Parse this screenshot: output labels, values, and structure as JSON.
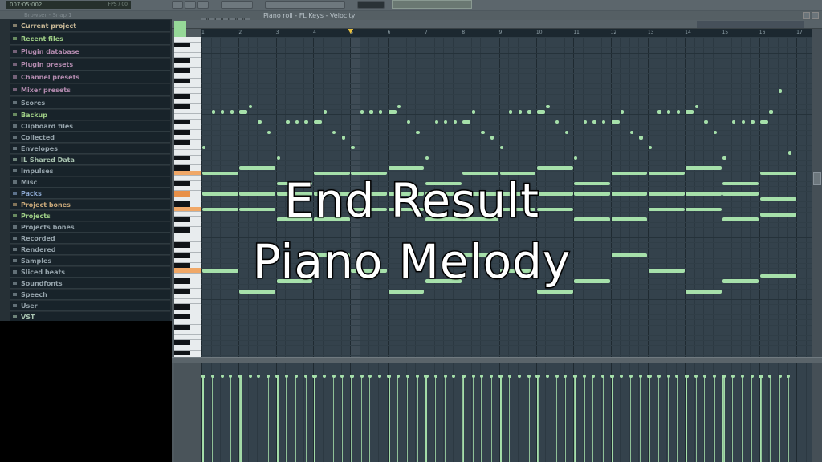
{
  "toolbar": {
    "time": "007:05:002",
    "fps": "FPS / 00"
  },
  "browser": {
    "title": "Browser - Snap 1",
    "items": [
      {
        "label": "Current project",
        "color": "#c9b997"
      },
      {
        "label": "Recent files",
        "color": "#9fcf86"
      },
      {
        "label": "Plugin database",
        "color": "#b28aae"
      },
      {
        "label": "Plugin presets",
        "color": "#b28aae"
      },
      {
        "label": "Channel presets",
        "color": "#b28aae"
      },
      {
        "label": "Mixer presets",
        "color": "#b28aae"
      },
      {
        "label": "Scores",
        "color": "#95a3ab"
      },
      {
        "label": "Backup",
        "color": "#9fcf86"
      },
      {
        "label": "Clipboard files",
        "color": "#95a3ab"
      },
      {
        "label": "Collected",
        "color": "#95a3ab"
      },
      {
        "label": "Envelopes",
        "color": "#95a3ab"
      },
      {
        "label": "IL Shared Data",
        "color": "#a9c4b0"
      },
      {
        "label": "Impulses",
        "color": "#95a3ab"
      },
      {
        "label": "Misc",
        "color": "#95a3ab"
      },
      {
        "label": "Packs",
        "color": "#8aa6cf"
      },
      {
        "label": "Project bones",
        "color": "#c8a87a"
      },
      {
        "label": "Projects",
        "color": "#9fcf86"
      },
      {
        "label": "Projects bones",
        "color": "#95a3ab"
      },
      {
        "label": "Recorded",
        "color": "#95a3ab"
      },
      {
        "label": "Rendered",
        "color": "#95a3ab"
      },
      {
        "label": "Samples",
        "color": "#95a3ab"
      },
      {
        "label": "Sliced beats",
        "color": "#95a3ab"
      },
      {
        "label": "Soundfonts",
        "color": "#95a3ab"
      },
      {
        "label": "Speech",
        "color": "#95a3ab"
      },
      {
        "label": "User",
        "color": "#95a3ab"
      },
      {
        "label": "VST",
        "color": "#a9c4b0"
      }
    ]
  },
  "piano_roll": {
    "title": "Piano roll - FL Keys - Velocity",
    "bars": [
      "1",
      "2",
      "3",
      "4",
      "5",
      "6",
      "7",
      "8",
      "9",
      "10",
      "11",
      "12",
      "13",
      "14",
      "15",
      "16",
      "17"
    ],
    "note_color": "#a6e0aa",
    "highlight_keys": [
      72,
      68,
      65,
      53
    ],
    "melody": [
      [
        [
          0,
          0.5,
          77
        ],
        [
          1,
          0.5,
          84
        ],
        [
          2,
          0.5,
          84
        ],
        [
          3,
          0.5,
          84
        ],
        [
          4,
          1,
          84
        ],
        [
          5,
          0.5,
          85
        ],
        [
          6,
          0.5,
          82
        ],
        [
          7,
          0.5,
          80
        ],
        [
          8,
          0.5,
          75
        ],
        [
          9,
          0.5,
          82
        ],
        [
          10,
          0.5,
          82
        ],
        [
          11,
          0.5,
          82
        ],
        [
          12,
          1,
          82
        ],
        [
          13,
          0.5,
          84
        ],
        [
          14,
          0.5,
          80
        ],
        [
          15,
          0.5,
          79
        ]
      ],
      [
        [
          48,
          0.5,
          77
        ],
        [
          49,
          0.5,
          84
        ],
        [
          50,
          0.5,
          84
        ],
        [
          51,
          0.5,
          84
        ],
        [
          52,
          1,
          84
        ],
        [
          53,
          0.5,
          85
        ],
        [
          54,
          0.5,
          82
        ],
        [
          55,
          0.5,
          80
        ],
        [
          56,
          0.5,
          75
        ],
        [
          57,
          0.5,
          82
        ],
        [
          58,
          0.5,
          82
        ],
        [
          59,
          0.5,
          82
        ],
        [
          60,
          1,
          82
        ],
        [
          61,
          0.5,
          84
        ],
        [
          62,
          0.5,
          88
        ],
        [
          63,
          0.5,
          76
        ]
      ]
    ],
    "chords": [
      [
        72,
        68,
        65,
        53
      ],
      [
        73,
        68,
        65,
        49
      ],
      [
        70,
        68,
        63,
        51
      ],
      [
        72,
        68,
        63,
        56
      ],
      [
        72,
        68,
        65,
        53
      ],
      [
        73,
        68,
        65,
        49
      ],
      [
        70,
        68,
        63,
        51
      ],
      [
        72,
        68,
        63,
        56
      ],
      [
        72,
        68,
        65,
        53
      ],
      [
        73,
        68,
        65,
        49
      ],
      [
        70,
        68,
        63,
        51
      ],
      [
        72,
        68,
        63,
        56
      ],
      [
        72,
        68,
        65,
        53
      ],
      [
        73,
        68,
        65,
        49
      ],
      [
        70,
        68,
        63,
        51
      ],
      [
        72,
        67,
        64,
        52
      ]
    ]
  },
  "overlay": {
    "line1": "End Result",
    "line2": "Piano Melody"
  }
}
